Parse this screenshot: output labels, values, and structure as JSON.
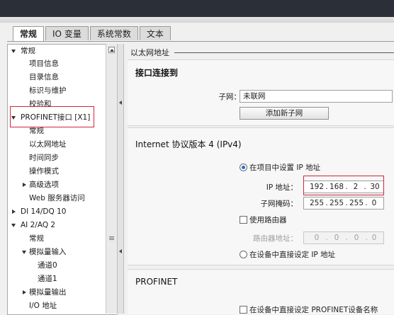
{
  "tabs": [
    {
      "label": "常规",
      "active": true
    },
    {
      "label": "IO 变量",
      "active": false
    },
    {
      "label": "系统常数",
      "active": false
    },
    {
      "label": "文本",
      "active": false
    }
  ],
  "tree": {
    "items": [
      {
        "label": "常规",
        "expand": "down"
      },
      {
        "label": "项目信息"
      },
      {
        "label": "目录信息"
      },
      {
        "label": "标识与维护"
      },
      {
        "label": "校验和"
      },
      {
        "label": "PROFINET接口 [X1]",
        "expand": "down"
      },
      {
        "label": "常规"
      },
      {
        "label": "以太网地址"
      },
      {
        "label": "时间同步"
      },
      {
        "label": "操作模式"
      },
      {
        "label": "高级选项",
        "expand": "right"
      },
      {
        "label": "Web 服务器访问"
      },
      {
        "label": "DI 14/DQ 10",
        "expand": "right"
      },
      {
        "label": "AI 2/AQ 2",
        "expand": "down"
      },
      {
        "label": "常规"
      },
      {
        "label": "模拟量输入",
        "expand": "down"
      },
      {
        "label": "通道0"
      },
      {
        "label": "通道1"
      },
      {
        "label": "模拟量输出",
        "expand": "right"
      },
      {
        "label": "I/O 地址"
      }
    ]
  },
  "content": {
    "section_title": "以太网地址",
    "interface": {
      "title": "接口连接到",
      "subnet_label": "子网：",
      "subnet_value": "未联网",
      "add_subnet_button": "添加新子网"
    },
    "ipv4": {
      "title": "Internet 协议版本 4 (IPv4)",
      "set_in_project_label": "在项目中设置 IP 地址",
      "set_in_project_selected": true,
      "ip_label": "IP 地址：",
      "ip": [
        "192",
        "168",
        "2",
        "30"
      ],
      "mask_label": "子网掩码：",
      "mask": [
        "255",
        "255",
        "255",
        "0"
      ],
      "use_router_label": "使用路由器",
      "use_router_checked": false,
      "router_label": "路由器地址：",
      "router": [
        "0",
        "0",
        "0",
        "0"
      ],
      "set_on_device_label": "在设备中直接设定 IP 地址",
      "set_on_device_selected": false,
      "dot": "."
    },
    "profinet": {
      "title": "PROFINET",
      "set_name_on_device_label": "在设备中直接设定 PROFINET设备名称",
      "set_name_on_device_checked": false
    }
  },
  "colors": {
    "highlight_red": "#d0263a",
    "radio_selected": "#1f6fd1"
  }
}
